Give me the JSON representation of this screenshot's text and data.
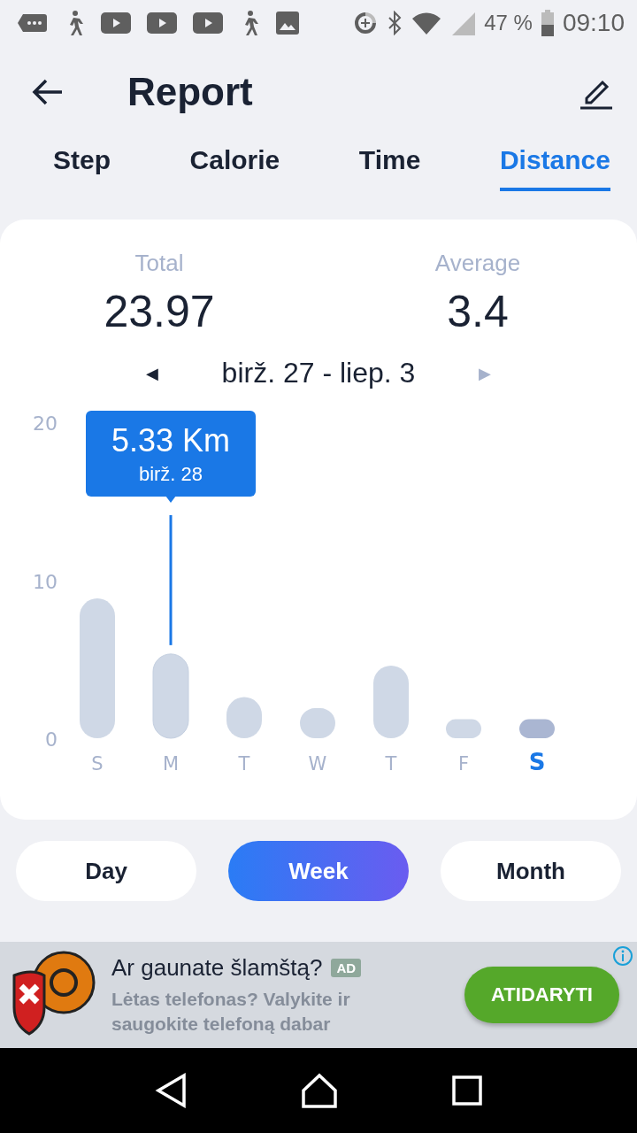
{
  "status_bar": {
    "battery": "47 %",
    "time": "09:10"
  },
  "header": {
    "title": "Report"
  },
  "tabs": [
    {
      "label": "Step",
      "selected": false
    },
    {
      "label": "Calorie",
      "selected": false
    },
    {
      "label": "Time",
      "selected": false
    },
    {
      "label": "Distance",
      "selected": true
    }
  ],
  "summary": [
    {
      "label": "Total",
      "value": "23.97"
    },
    {
      "label": "Average",
      "value": "3.4"
    }
  ],
  "date_range": {
    "prev": "◀",
    "label": "birž. 27 - liep. 3",
    "next": "▶"
  },
  "chart": {
    "tooltip": {
      "value": "5.33 Km",
      "date": "birž. 28"
    },
    "bars": [
      {
        "selected": false,
        "focused": false,
        "color": "#cfd8e6"
      },
      {
        "selected": false,
        "focused": true,
        "color": "#cfd8e6"
      },
      {
        "selected": false,
        "focused": false,
        "color": "#cfd8e6"
      },
      {
        "selected": false,
        "focused": false,
        "color": "#cfd8e6"
      },
      {
        "selected": false,
        "focused": false,
        "color": "#cfd8e6"
      },
      {
        "selected": false,
        "focused": false,
        "color": "#cfd8e6"
      },
      {
        "selected": true,
        "focused": false,
        "color": "#aab6d2"
      }
    ],
    "chart_data": {
      "type": "bar",
      "categories": [
        "S",
        "M",
        "T",
        "W",
        "T",
        "F",
        "S"
      ],
      "series": [
        {
          "values": [
            8.85,
            5.33,
            2.6,
            1.9,
            4.6,
            1.2,
            1.2
          ]
        }
      ],
      "ylim": [
        0,
        20
      ],
      "yticks": [
        0,
        10,
        20
      ]
    }
  },
  "periods": [
    {
      "label": "Day",
      "selected": false
    },
    {
      "label": "Week",
      "selected": true
    },
    {
      "label": "Month",
      "selected": false
    }
  ],
  "ad": {
    "title": "Ar gaunate šlamštą?",
    "badge": "AD",
    "text": "Lėtas telefonas? Valykite ir saugokite telefoną dabar",
    "button": "ATIDARYTI"
  }
}
